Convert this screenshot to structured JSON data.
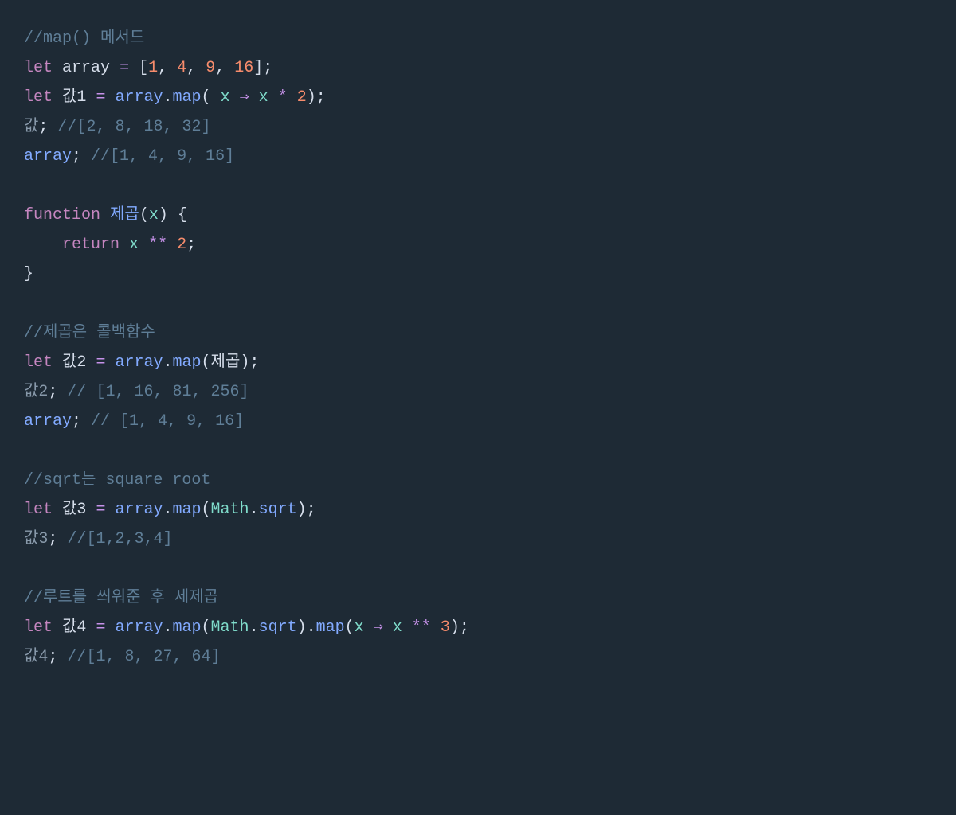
{
  "code": {
    "l1": {
      "c1": "//map() 메서드"
    },
    "l2": {
      "kw": "let",
      "var": "array",
      "eq": "=",
      "lb": "[",
      "n1": "1",
      "c": ",",
      "n2": "4",
      "n3": "9",
      "n4": "16",
      "rb": "]",
      "semi": ";"
    },
    "l3": {
      "kw": "let",
      "var": "값1",
      "eq": "=",
      "arr": "array",
      "dot": ".",
      "method": "map",
      "lp": "(",
      "param": "x",
      "arrow": "⇒",
      "x2": "x",
      "star": "*",
      "n": "2",
      "rp": ")",
      "semi": ";"
    },
    "l4": {
      "var": "값",
      "semi": ";",
      "c": "//[2, 8, 18, 32]"
    },
    "l5": {
      "var": "array",
      "semi": ";",
      "c": "//[1, 4, 9, 16]"
    },
    "l7": {
      "kw": "function",
      "name": "제곱",
      "lp": "(",
      "param": "x",
      "rp": ")",
      "lb": "{"
    },
    "l8": {
      "kw": "return",
      "x": "x",
      "op": "**",
      "n": "2",
      "semi": ";"
    },
    "l9": {
      "rb": "}"
    },
    "l11": {
      "c": "//제곱은 콜백함수"
    },
    "l12": {
      "kw": "let",
      "var": "값2",
      "eq": "=",
      "arr": "array",
      "dot": ".",
      "method": "map",
      "lp": "(",
      "arg": "제곱",
      "rp": ")",
      "semi": ";"
    },
    "l13": {
      "var": "값2",
      "semi": ";",
      "c": "// [1, 16, 81, 256]"
    },
    "l14": {
      "var": "array",
      "semi": ";",
      "c": "// [1, 4, 9, 16]"
    },
    "l16": {
      "c": "//sqrt는 square root"
    },
    "l17": {
      "kw": "let",
      "var": "값3",
      "eq": "=",
      "arr": "array",
      "dot": ".",
      "method": "map",
      "lp": "(",
      "cls": "Math",
      "dot2": ".",
      "fn": "sqrt",
      "rp": ")",
      "semi": ";"
    },
    "l18": {
      "var": "값3",
      "semi": ";",
      "c": "//[1,2,3,4]"
    },
    "l20": {
      "c": "//루트를 씌워준 후 세제곱"
    },
    "l21": {
      "kw": "let",
      "var": "값4",
      "eq": "=",
      "arr": "array",
      "dot": ".",
      "method": "map",
      "lp": "(",
      "cls": "Math",
      "dot2": ".",
      "fn": "sqrt",
      "rp": ")",
      "dot3": ".",
      "method2": "map",
      "lp2": "(",
      "param": "x",
      "arrow": "⇒",
      "x2": "x",
      "op": "**",
      "n": "3",
      "rp2": ")",
      "semi": ";"
    },
    "l22": {
      "var": "값4",
      "semi": ";",
      "c": "//[1, 8, 27, 64]"
    }
  }
}
